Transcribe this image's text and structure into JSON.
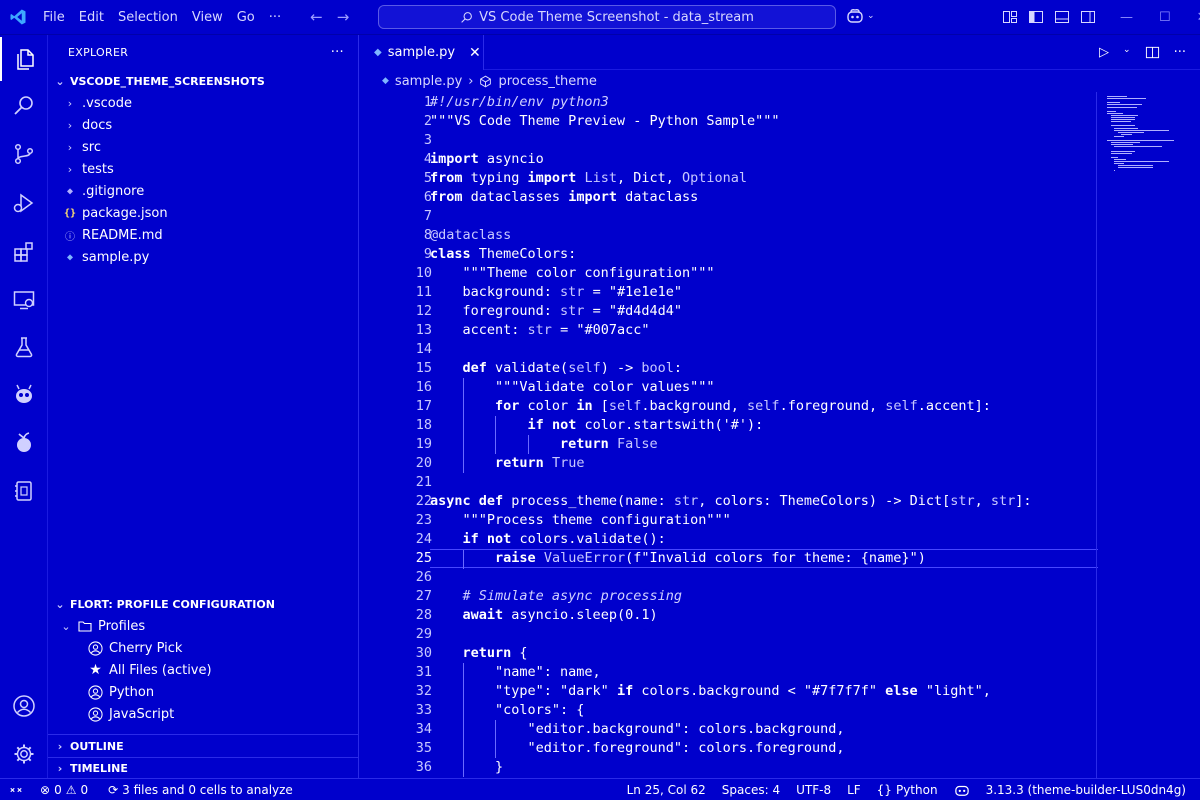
{
  "titlebar": {
    "menu": [
      "File",
      "Edit",
      "Selection",
      "View",
      "Go",
      "···"
    ],
    "search_text": "VS Code Theme Screenshot - data_stream"
  },
  "sidebar": {
    "header": "EXPLORER",
    "more": "···",
    "workspace": "VSCODE_THEME_SCREENSHOTS",
    "items": [
      {
        "label": ".vscode",
        "kind": "folder"
      },
      {
        "label": "docs",
        "kind": "folder"
      },
      {
        "label": "src",
        "kind": "folder"
      },
      {
        "label": "tests",
        "kind": "folder"
      },
      {
        "label": ".gitignore",
        "kind": "gitignore"
      },
      {
        "label": "package.json",
        "kind": "json"
      },
      {
        "label": "README.md",
        "kind": "info"
      },
      {
        "label": "sample.py",
        "kind": "python"
      }
    ],
    "profile_section": "FLORT: PROFILE CONFIGURATION",
    "profiles_folder": "Profiles",
    "profiles": [
      {
        "label": "Cherry Pick",
        "icon": "account"
      },
      {
        "label": "All Files (active)",
        "icon": "star"
      },
      {
        "label": "Python",
        "icon": "account"
      },
      {
        "label": "JavaScript",
        "icon": "account"
      }
    ],
    "outline": "OUTLINE",
    "timeline": "TIMELINE"
  },
  "editor": {
    "tab_label": "sample.py",
    "breadcrumb_file": "sample.py",
    "breadcrumb_symbol": "process_theme",
    "current_line": 25,
    "lines": [
      "#!/usr/bin/env python3",
      "\"\"\"VS Code Theme Preview - Python Sample\"\"\"",
      "",
      "import asyncio",
      "from typing import List, Dict, Optional",
      "from dataclasses import dataclass",
      "",
      "@dataclass",
      "class ThemeColors:",
      "    \"\"\"Theme color configuration\"\"\"",
      "    background: str = \"#1e1e1e\"",
      "    foreground: str = \"#d4d4d4\"",
      "    accent: str = \"#007acc\"",
      "",
      "    def validate(self) -> bool:",
      "        \"\"\"Validate color values\"\"\"",
      "        for color in [self.background, self.foreground, self.accent]:",
      "            if not color.startswith('#'):",
      "                return False",
      "        return True",
      "",
      "async def process_theme(name: str, colors: ThemeColors) -> Dict[str, str]:",
      "    \"\"\"Process theme configuration\"\"\"",
      "    if not colors.validate():",
      "        raise ValueError(f\"Invalid colors for theme: {name}\")",
      "",
      "    # Simulate async processing",
      "    await asyncio.sleep(0.1)",
      "",
      "    return {",
      "        \"name\": name,",
      "        \"type\": \"dark\" if colors.background < \"#7f7f7f\" else \"light\",",
      "        \"colors\": {",
      "            \"editor.background\": colors.background,",
      "            \"editor.foreground\": colors.foreground,",
      "        }"
    ]
  },
  "statusbar": {
    "errors": "0",
    "warnings": "0",
    "analysis": "3 files and 0 cells to analyze",
    "position": "Ln 25, Col 62",
    "spaces": "Spaces: 4",
    "encoding": "UTF-8",
    "eol": "LF",
    "language": "Python",
    "interpreter": "3.13.3 (theme-builder-LUS0dn4g)"
  },
  "colors": {
    "background": "#0000cc",
    "foreground": "#ffffff",
    "accent": "#ffffff"
  }
}
